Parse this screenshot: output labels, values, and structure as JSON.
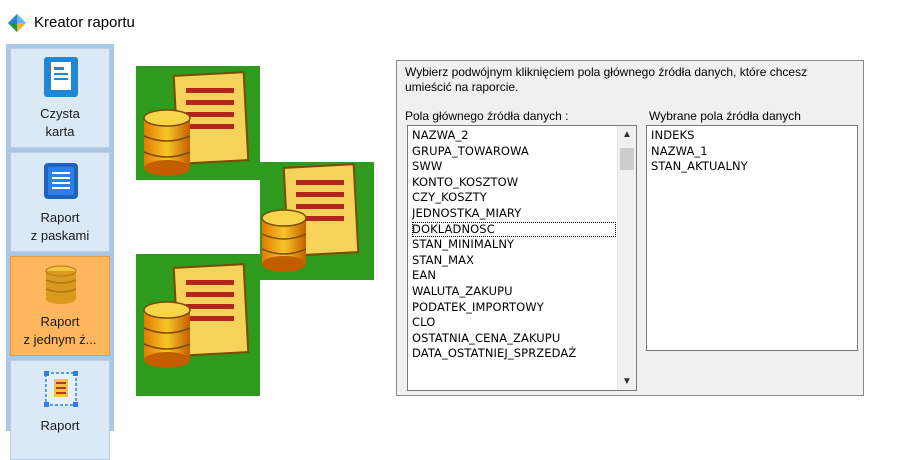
{
  "window": {
    "title": "Kreator raportu"
  },
  "sidebar": {
    "items": [
      {
        "line1": "Czysta",
        "line2": "karta",
        "icon": "blank-page-icon",
        "active": false
      },
      {
        "line1": "Raport",
        "line2": "z paskami",
        "icon": "banded-report-icon",
        "active": false
      },
      {
        "line1": "Raport",
        "line2": "z jednym ź...",
        "icon": "database-icon",
        "active": true
      },
      {
        "line1": "Raport",
        "line2": "",
        "icon": "grouped-report-icon",
        "active": false
      }
    ]
  },
  "panel": {
    "instruction": "Wybierz podwójnym kliknięciem pola głównego źródła danych, które chcesz umieścić na raporcie.",
    "source_label": "Pola głównego źródła danych :",
    "selected_label": "Wybrane pola źródła danych",
    "source_fields": [
      "NAZWA_2",
      "GRUPA_TOWAROWA",
      "SWW",
      "KONTO_KOSZTOW",
      "CZY_KOSZTY",
      "JEDNOSTKA_MIARY",
      "DOKLADNOSC",
      "STAN_MINIMALNY",
      "STAN_MAX",
      "EAN",
      "WALUTA_ZAKUPU",
      "PODATEK_IMPORTOWY",
      "CLO",
      "OSTATNIA_CENA_ZAKUPU",
      "DATA_OSTATNIEJ_SPRZEDAŻ"
    ],
    "focused_field": "DOKLADNOSC",
    "selected_fields": [
      "INDEKS",
      "NAZWA_1",
      "STAN_AKTUALNY"
    ]
  },
  "colors": {
    "sidebar_bg": "#a9c7e6",
    "sidebar_item_bg": "#dbe8f6",
    "sidebar_active_bg": "#ffb65c",
    "illustration_green": "#2e9b1e"
  }
}
